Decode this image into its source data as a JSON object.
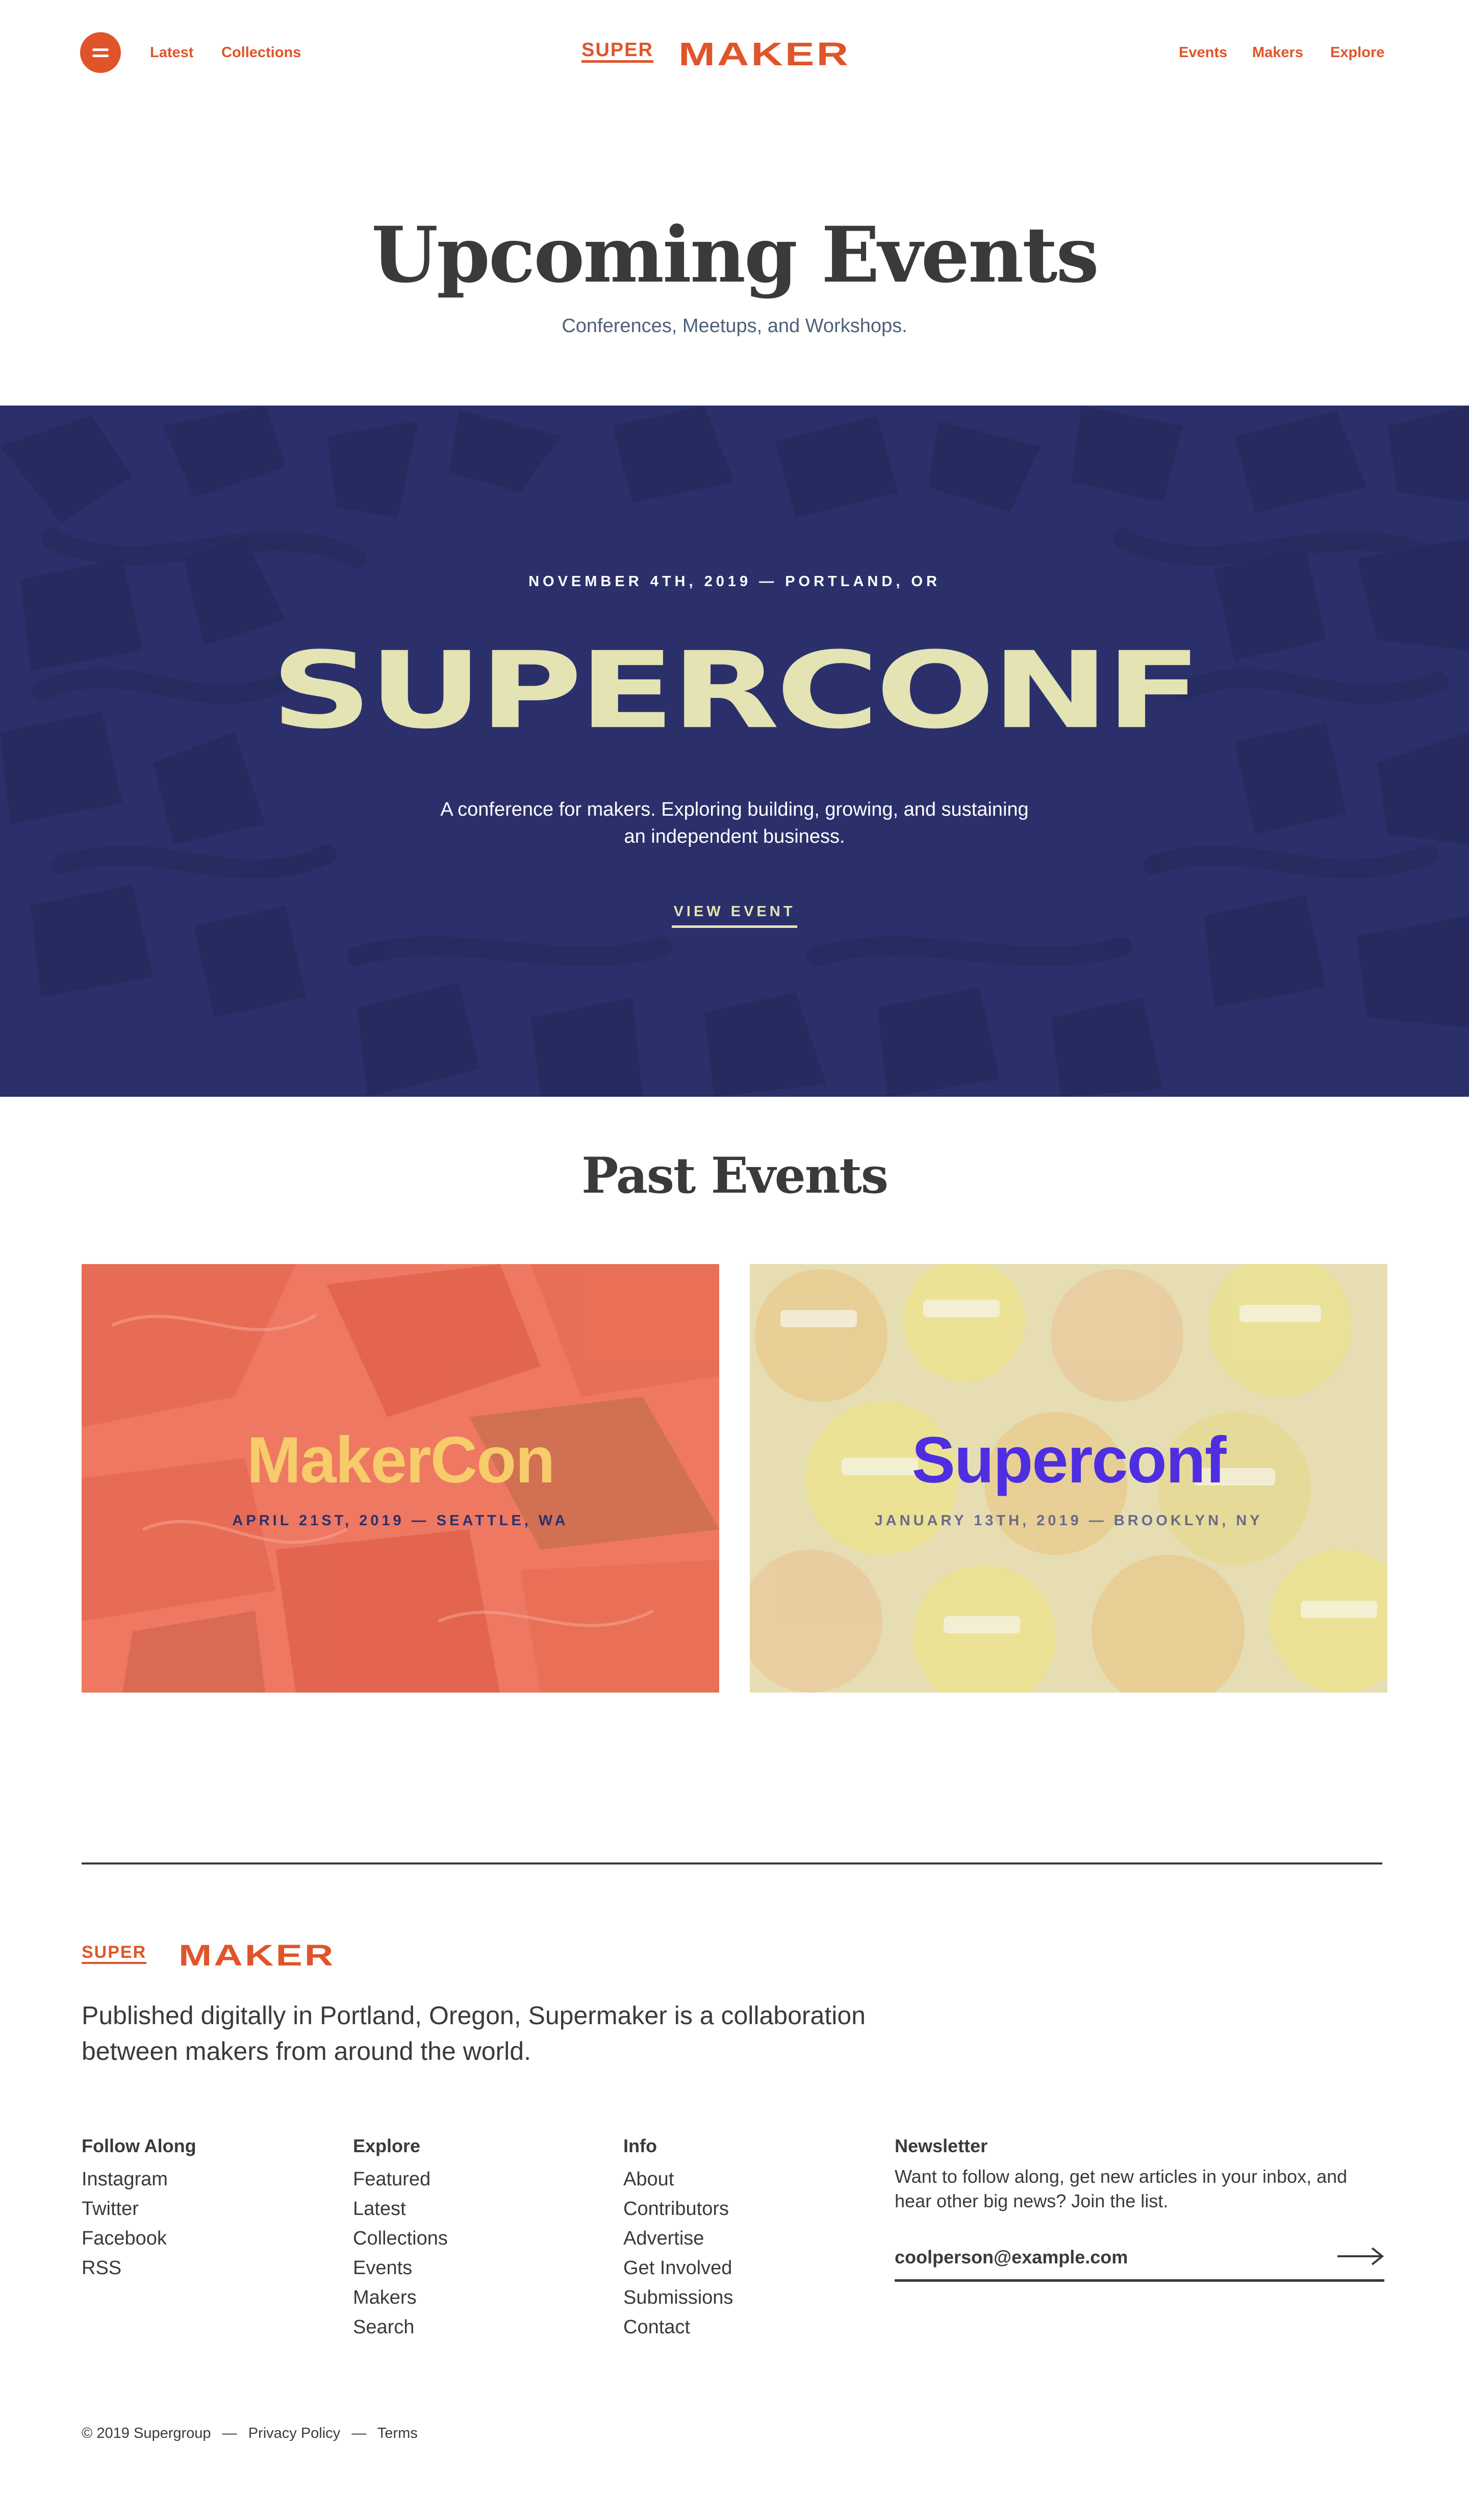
{
  "header": {
    "left_links": [
      "Latest",
      "Collections"
    ],
    "right_links": [
      "Events",
      "Makers",
      "Explore"
    ],
    "logo": {
      "super": "SUPER",
      "maker": "MAKER"
    },
    "accent_color": "#e0542a"
  },
  "page": {
    "title": "Upcoming Events",
    "subtitle": "Conferences, Meetups, and Workshops."
  },
  "hero": {
    "date": "NOVEMBER 4TH, 2019 — PORTLAND, OR",
    "title": "SUPERCONF",
    "description": "A conference for makers. Exploring building, growing, and sustaining an independent business.",
    "button": "VIEW EVENT",
    "background_color": "#2b306b"
  },
  "past_events": {
    "title": "Past Events",
    "items": [
      {
        "name": "MakerCon",
        "meta": "APRIL 21ST, 2019 — SEATTLE, WA"
      },
      {
        "name": "Superconf",
        "meta": "JANUARY 13TH, 2019 — BROOKLYN, NY"
      }
    ]
  },
  "footer": {
    "logo": {
      "super": "SUPER",
      "maker": "MAKER"
    },
    "about": "Published digitally in Portland, Oregon, Supermaker is a collaboration between makers from around the world.",
    "columns": {
      "follow": {
        "title": "Follow Along",
        "links": [
          "Instagram",
          "Twitter",
          "Facebook",
          "RSS"
        ]
      },
      "explore": {
        "title": "Explore",
        "links": [
          "Featured",
          "Latest",
          "Collections",
          "Events",
          "Makers",
          "Search"
        ]
      },
      "info": {
        "title": "Info",
        "links": [
          "About",
          "Contributors",
          "Advertise",
          "Get Involved",
          "Submissions",
          "Contact"
        ]
      }
    },
    "newsletter": {
      "title": "Newsletter",
      "text": "Want to follow along, get new articles in your inbox, and hear other big news? Join the list.",
      "placeholder": "coolperson@example.com",
      "submit_icon": "arrow-right-icon"
    },
    "legal": {
      "copyright": "© 2019 Supergroup",
      "separator": "—",
      "privacy": "Privacy Policy",
      "terms": "Terms"
    }
  }
}
